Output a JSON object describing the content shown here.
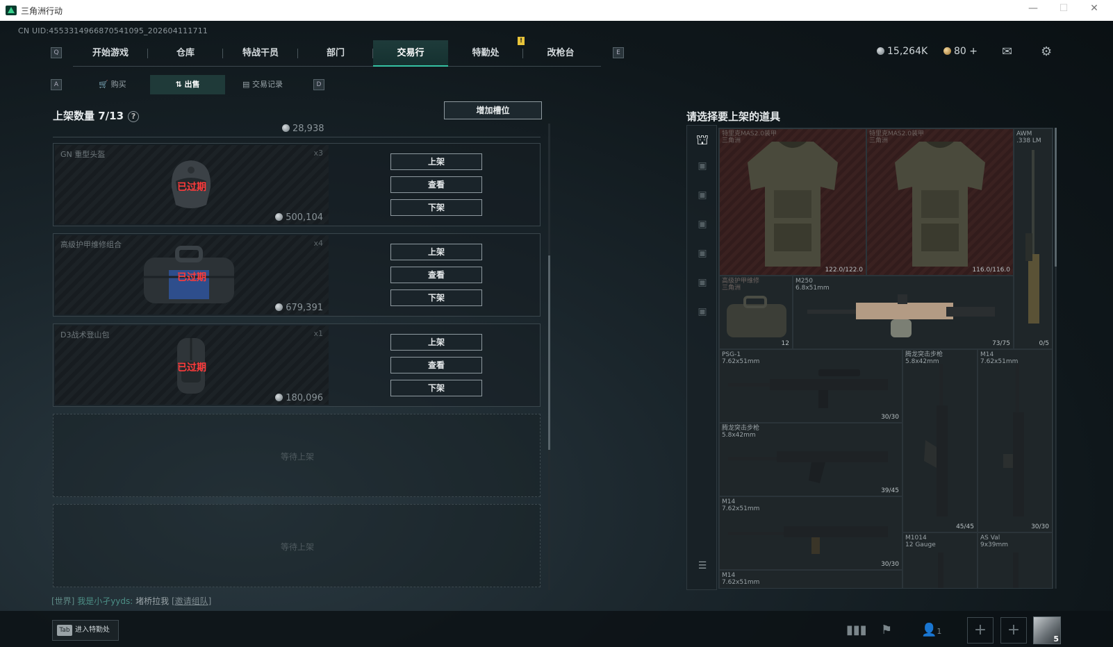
{
  "window": {
    "title": "三角洲行动",
    "controls": [
      "—",
      "☐",
      "✕"
    ]
  },
  "uid": "CN UID:4553314966870541095_202604111711",
  "keys": {
    "left_nav": "Q",
    "right_nav": "E",
    "left_sub": "A",
    "right_sub": "D"
  },
  "nav": {
    "tabs": [
      "开始游戏",
      "仓库",
      "特战干员",
      "部门",
      "交易行",
      "特勤处",
      "改枪台"
    ],
    "active": 4
  },
  "subnav": {
    "tabs": [
      "购买",
      "出售",
      "交易记录"
    ],
    "active": 1
  },
  "currency": {
    "havcoin": "15,264K",
    "tickets": "80",
    "plus": "+"
  },
  "listing": {
    "header": "上架数量 7/13",
    "help": "?",
    "add_slot": "增加槽位",
    "prev_price": "28,938",
    "items": [
      {
        "name": "GN 重型头盔",
        "count": "x3",
        "status": "已过期",
        "price": "500,104",
        "actions": [
          "上架",
          "查看",
          "下架"
        ]
      },
      {
        "name": "高级护甲维修组合",
        "count": "x4",
        "status": "已过期",
        "price": "679,391",
        "actions": [
          "上架",
          "查看",
          "下架"
        ]
      },
      {
        "name": "D3战术登山包",
        "count": "x1",
        "status": "已过期",
        "price": "180,096",
        "actions": [
          "上架",
          "查看",
          "下架"
        ]
      }
    ],
    "empty_slot": "等待上架"
  },
  "inventory": {
    "title": "请选择要上架的道具",
    "cells": [
      {
        "name": "特里克MAS2.0装甲",
        "sub": "三角洲",
        "durability": "122.0/122.0"
      },
      {
        "name": "特里克MAS2.0装甲",
        "sub": "三角洲",
        "durability": "116.0/116.0"
      },
      {
        "name": "AWM",
        "sub": ".338 LM",
        "durability": "0/5"
      },
      {
        "name": "高级护甲维修",
        "sub": "三角洲",
        "durability": "12"
      },
      {
        "name": "M250",
        "sub": "6.8x51mm",
        "durability": "73/75"
      },
      {
        "name": "PSG-1",
        "sub": "7.62x51mm",
        "durability": "30/30"
      },
      {
        "name": "腾龙突击步枪",
        "sub": "5.8x42mm",
        "durability": "45/45"
      },
      {
        "name": "M14",
        "sub": "7.62x51mm",
        "durability": "30/30"
      },
      {
        "name": "腾龙突击步枪",
        "sub": "5.8x42mm",
        "durability": "39/45"
      },
      {
        "name": "M14",
        "sub": "7.62x51mm",
        "durability": "30/30"
      },
      {
        "name": "M1014",
        "sub": "12 Gauge",
        "durability": ""
      },
      {
        "name": "AS Val",
        "sub": "9x39mm",
        "durability": ""
      },
      {
        "name": "M14",
        "sub": "7.62x51mm",
        "durability": ""
      }
    ]
  },
  "chat": {
    "channel": "[世界]",
    "user": "我是小孑yyds:",
    "message": "堵桥拉我",
    "invite": "[邀请组队]"
  },
  "bottom": {
    "tab_key": "Tab",
    "tab_label": "进入特勤处",
    "party_count": "1",
    "level": "5"
  },
  "colors": {
    "accent": "#36c3a4",
    "expired": "#ff3b3b",
    "warning": "#e8c43a"
  }
}
